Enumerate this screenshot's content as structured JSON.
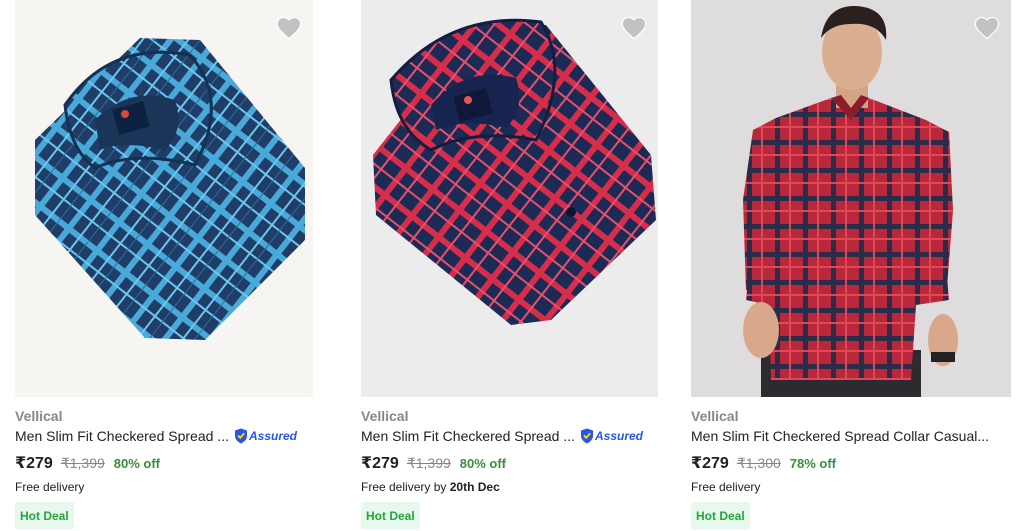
{
  "products": [
    {
      "brand": "Vellical",
      "title": "Men Slim Fit Checkered Spread ...",
      "assured": true,
      "assured_label": "Assured",
      "price": "₹279",
      "mrp": "₹1,399",
      "discount": "80% off",
      "delivery": "Free delivery",
      "delivery_date": "",
      "deal": "Hot Deal",
      "image_desc": "folded blue checkered shirt"
    },
    {
      "brand": "Vellical",
      "title": "Men Slim Fit Checkered Spread ...",
      "assured": true,
      "assured_label": "Assured",
      "price": "₹279",
      "mrp": "₹1,399",
      "discount": "80% off",
      "delivery": "Free delivery by",
      "delivery_date": "20th Dec",
      "deal": "Hot Deal",
      "image_desc": "folded red and navy checkered shirt"
    },
    {
      "brand": "Vellical",
      "title": "Men Slim Fit Checkered Spread Collar Casual...",
      "assured": false,
      "assured_label": "",
      "price": "₹279",
      "mrp": "₹1,300",
      "discount": "78% off",
      "delivery": "Free delivery",
      "delivery_date": "",
      "deal": "Hot Deal",
      "image_desc": "model wearing red checkered shirt"
    }
  ],
  "colors": {
    "brand_gray": "#878787",
    "discount_green": "#388e3c",
    "deal_bg": "#e7f8ec",
    "deal_text": "#26a541",
    "assured_blue": "#2a55e5",
    "wishlist_gray": "#c2c2c2"
  },
  "icons": {
    "wishlist": "heart-icon",
    "assured": "shield-icon"
  }
}
